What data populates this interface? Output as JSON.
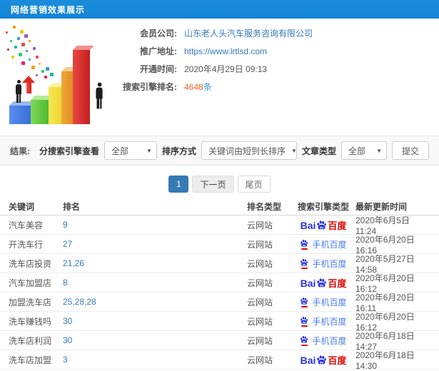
{
  "header": {
    "title": "网络营销效果展示"
  },
  "info": {
    "fields": [
      {
        "label": "会员公司:",
        "value": "山东老人头汽车服务咨询有限公司",
        "type": "link",
        "name": "member-company"
      },
      {
        "label": "推广地址:",
        "value": "https://www.lrtlsd.com",
        "type": "link",
        "name": "promotion-url"
      },
      {
        "label": "开通时间:",
        "value": "2020年4月29日 09:13",
        "type": "text",
        "name": "open-time"
      },
      {
        "label": "搜索引擎排名:",
        "value": "4648",
        "suffix": "条",
        "type": "highlight",
        "name": "engine-rank-count"
      }
    ]
  },
  "filters": {
    "result_label": "结果:",
    "engine_label": "分搜索引擎查看",
    "engine_value": "全部",
    "sort_label": "排序方式",
    "sort_value": "关键词由短到长排序",
    "article_label": "文章类型",
    "article_value": "全部",
    "submit_label": "提交"
  },
  "pagination": {
    "current": "1",
    "next": "下一页",
    "last": "尾页"
  },
  "table": {
    "columns": [
      "关键词",
      "排名",
      "排名类型",
      "搜索引擎类型",
      "最新更新时间"
    ],
    "rows": [
      {
        "keyword": "汽车美容",
        "rank": "9",
        "rank_type": "云网站",
        "engine": "baidu",
        "updated": "2020年6月5日 11:24"
      },
      {
        "keyword": "开洗车行",
        "rank": "27",
        "rank_type": "云网站",
        "engine": "mobile-baidu",
        "updated": "2020年6月20日 16:16"
      },
      {
        "keyword": "洗车店投资",
        "rank": "21,26",
        "rank_type": "云网站",
        "engine": "mobile-baidu",
        "updated": "2020年5月27日 14:58"
      },
      {
        "keyword": "汽车加盟店",
        "rank": "8",
        "rank_type": "云网站",
        "engine": "baidu",
        "updated": "2020年6月20日 16:12"
      },
      {
        "keyword": "加盟洗车店",
        "rank": "25,28,28",
        "rank_type": "云网站",
        "engine": "mobile-baidu",
        "updated": "2020年6月20日 16:11"
      },
      {
        "keyword": "洗车赚钱吗",
        "rank": "30",
        "rank_type": "云网站",
        "engine": "mobile-baidu",
        "updated": "2020年6月20日 16:12"
      },
      {
        "keyword": "洗车店利润",
        "rank": "30",
        "rank_type": "云网站",
        "engine": "mobile-baidu",
        "updated": "2020年6月18日 14:27"
      },
      {
        "keyword": "洗车店加盟",
        "rank": "3",
        "rank_type": "云网站",
        "engine": "baidu",
        "updated": "2020年6月18日 14:30"
      }
    ]
  },
  "engine_logos": {
    "baidu_prefix": "Bai",
    "baidu_suffix": "百度",
    "mobile_label": "手机百度"
  },
  "colors": {
    "header_bg": "#1687d8",
    "link": "#337ab7",
    "highlight_orange": "#f4602a",
    "highlight_blue": "#2f9ae0",
    "baidu_blue": "#2932e1",
    "baidu_red": "#e10602",
    "mobile_link_blue": "#4a7cf5",
    "active_page_bg": "#337ab7"
  }
}
